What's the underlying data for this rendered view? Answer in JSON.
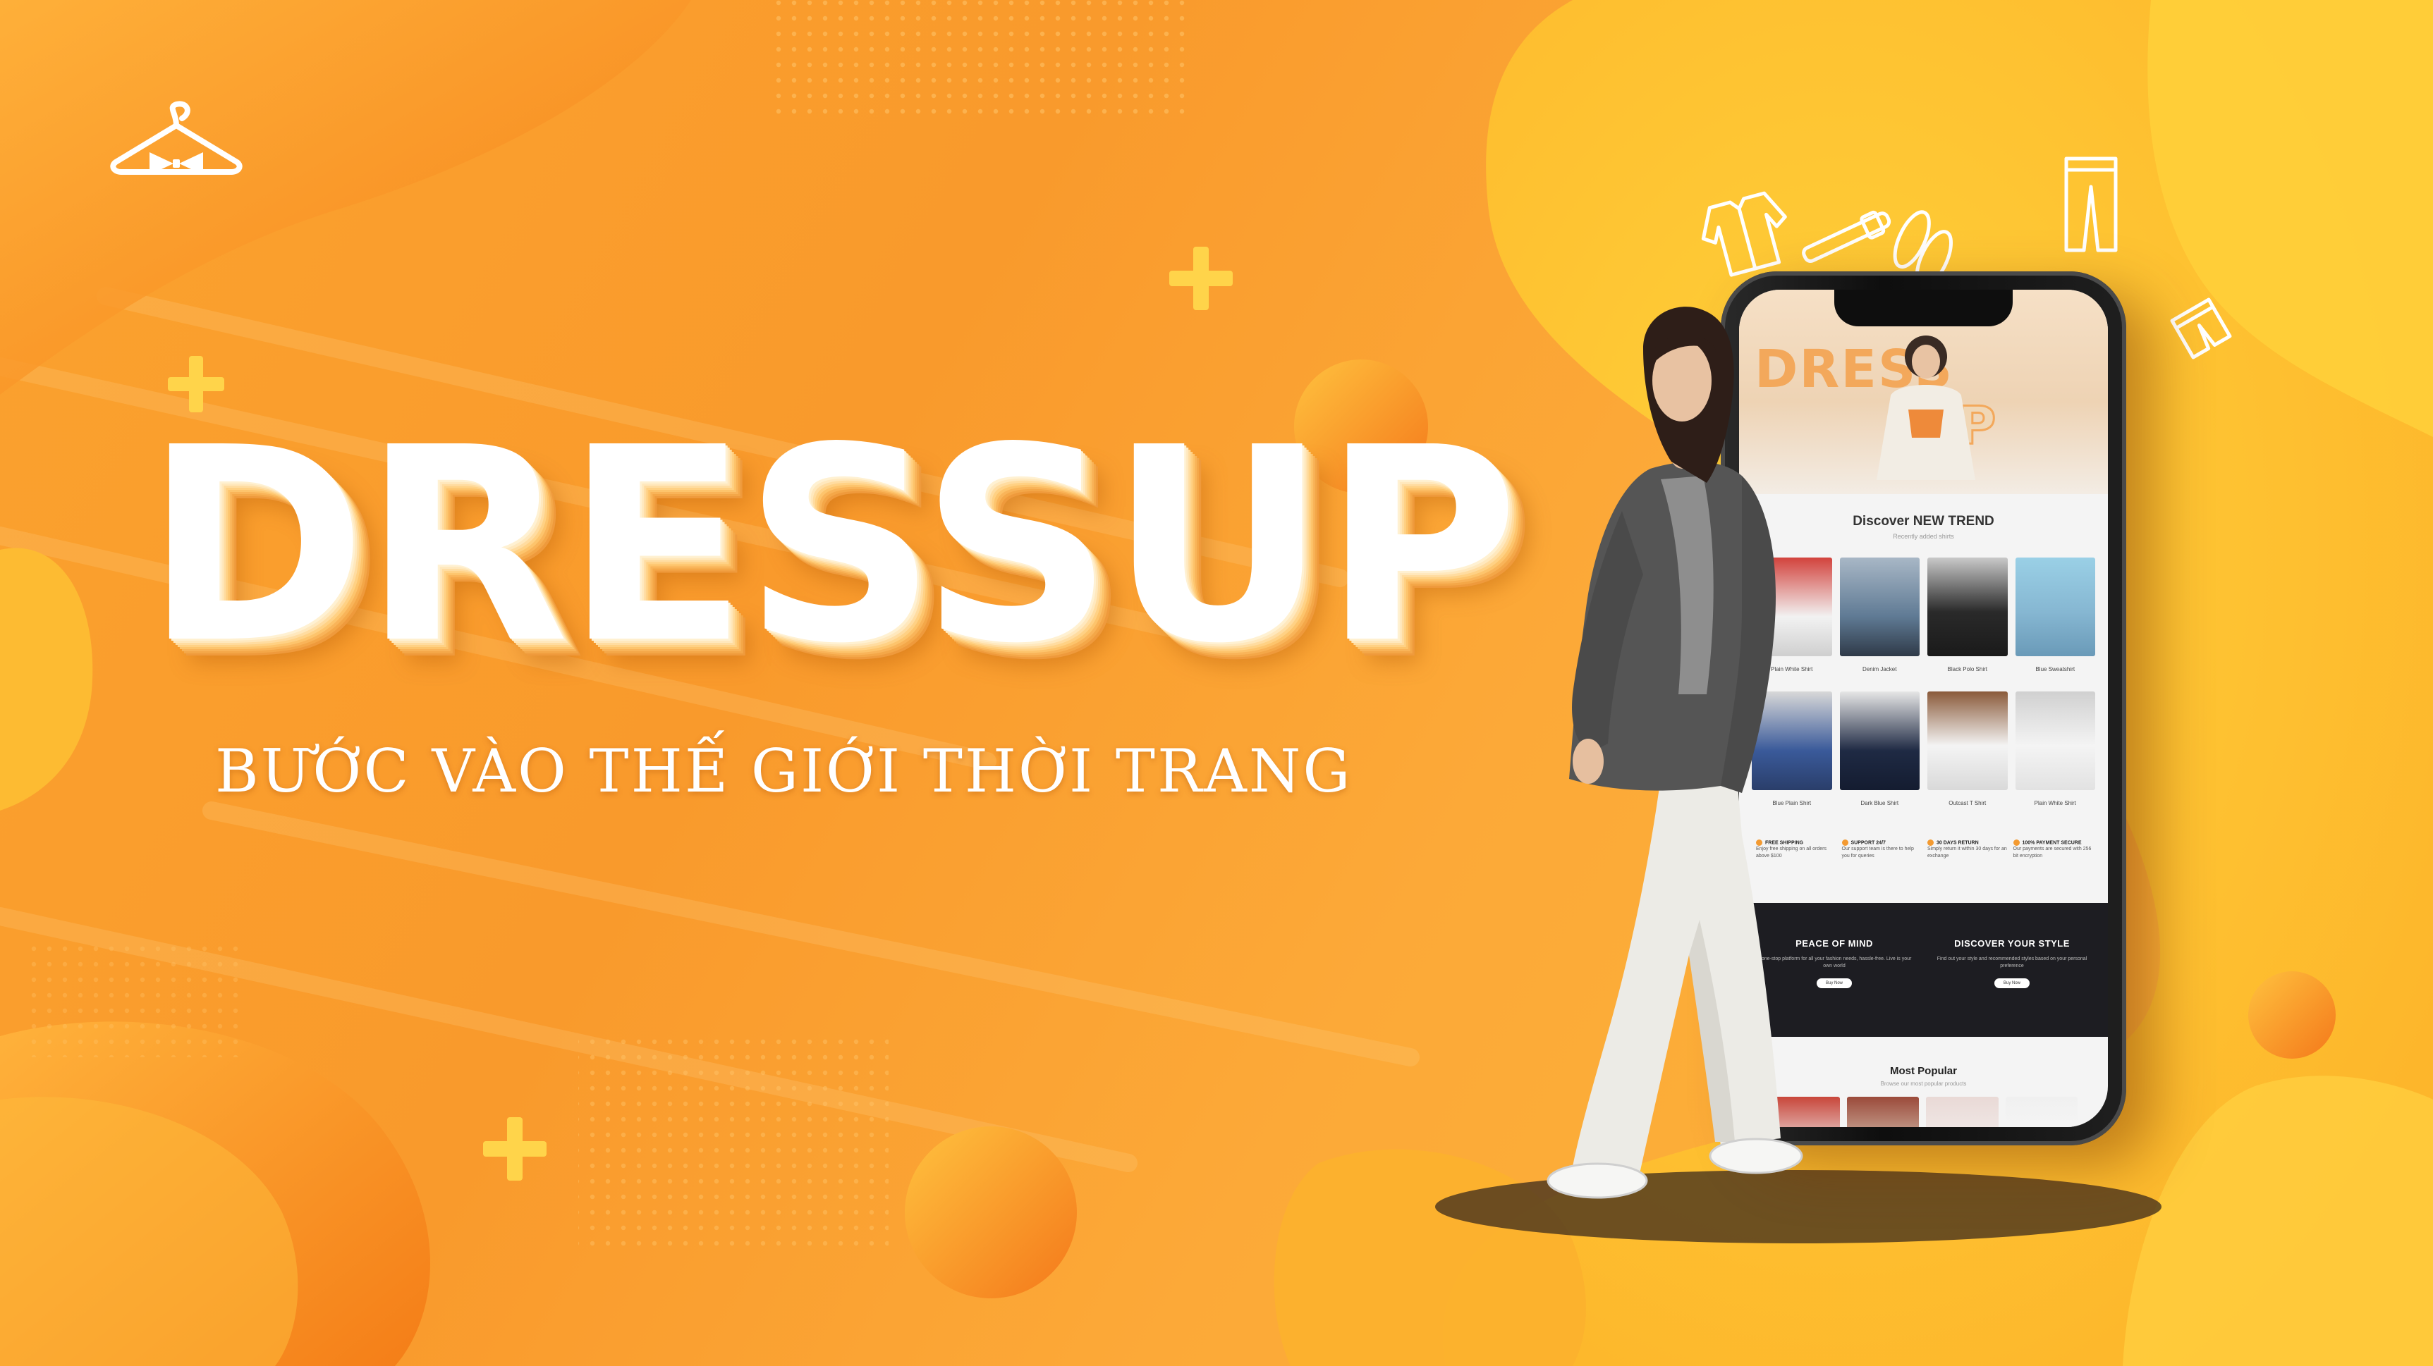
{
  "brand": {
    "headline": "DRESSUP",
    "tagline": "BƯỚC VÀO THẾ GIỚI THỜI TRANG"
  },
  "icons": [
    "hanger-logo-icon",
    "plus-icon",
    "jacket-icon",
    "belt-icon",
    "shoes-icon",
    "pants-icon",
    "shorts-icon"
  ],
  "colors": {
    "background": "#fba22e",
    "blob_yellow": "#fdc12f",
    "accent_orange": "#f7801d",
    "white": "#ffffff"
  },
  "phone_screen": {
    "hero": {
      "word_top": "DRESS",
      "word_bottom": "UP"
    },
    "trend": {
      "title": "Discover NEW TREND",
      "subtitle": "Recently added shirts",
      "items": [
        "Plain White Shirt",
        "Denim Jacket",
        "Black Polo Shirt",
        "Blue Sweatshirt",
        "Blue Plain Shirt",
        "Dark Blue Shirt",
        "Outcast T Shirt",
        "Plain White Shirt"
      ]
    },
    "features": [
      {
        "title": "FREE SHIPPING",
        "desc": "Enjoy free shipping on all orders above $100"
      },
      {
        "title": "SUPPORT 24/7",
        "desc": "Our support team is there to help you for queries"
      },
      {
        "title": "30 DAYS RETURN",
        "desc": "Simply return it within 30 days for an exchange"
      },
      {
        "title": "100% PAYMENT SECURE",
        "desc": "Our payments are secured with 256 bit encryption"
      }
    ],
    "promo": [
      {
        "title": "PEACE OF MIND",
        "desc": "A one-stop platform for all your fashion needs, hassle-free. Live is your own world",
        "button": "Buy Now"
      },
      {
        "title": "DISCOVER YOUR STYLE",
        "desc": "Find out your style and recommended styles based on your personal preference",
        "button": "Buy Now"
      }
    ],
    "popular": {
      "title": "Most Popular",
      "subtitle": "Browse our most popular products"
    }
  }
}
